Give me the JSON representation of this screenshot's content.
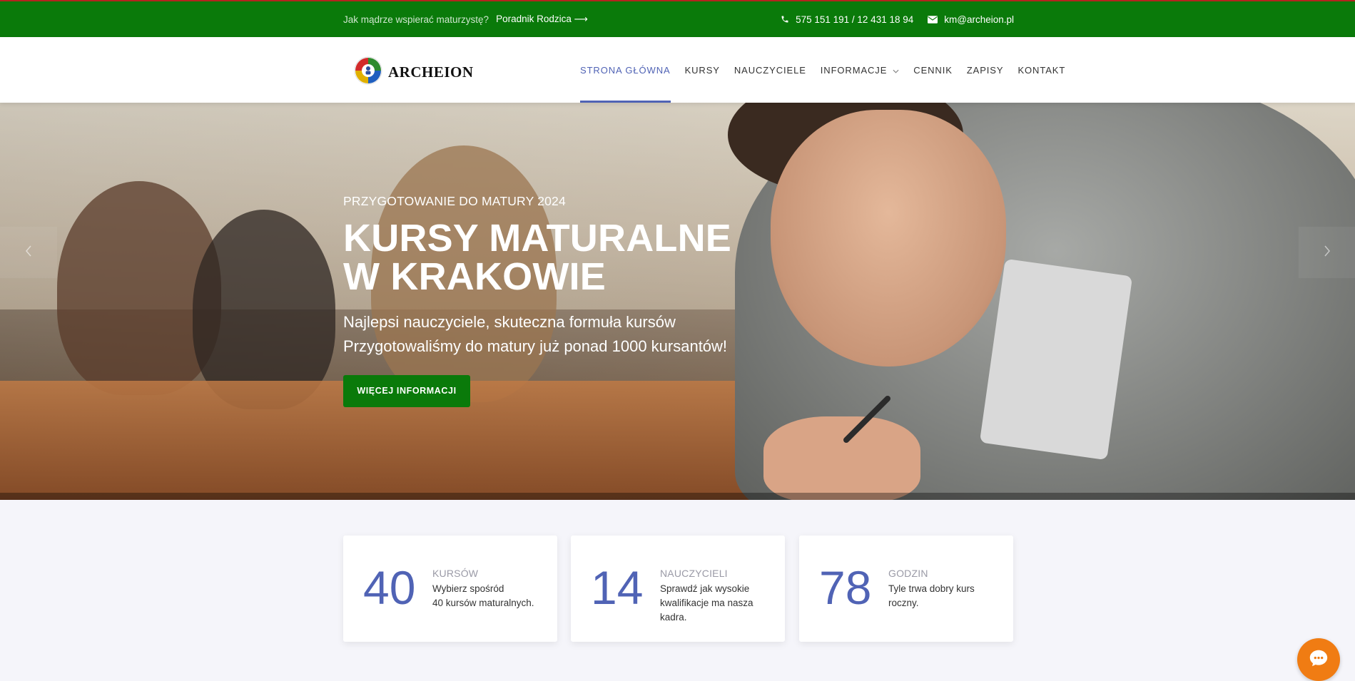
{
  "topbar": {
    "question": "Jak mądrze wspierać maturzystę?",
    "guide_link": "Poradnik Rodzica ⟶",
    "phone": "575 151 191 / 12 431 18 94",
    "email": "km@archeion.pl"
  },
  "header": {
    "logo_text": "ARCHEION",
    "nav": [
      {
        "label": "STRONA GŁÓWNA",
        "active": true
      },
      {
        "label": "KURSY"
      },
      {
        "label": "NAUCZYCIELE"
      },
      {
        "label": "INFORMACJE",
        "has_dropdown": true
      },
      {
        "label": "CENNIK"
      },
      {
        "label": "ZAPISY"
      },
      {
        "label": "KONTAKT"
      }
    ]
  },
  "hero": {
    "eyebrow": "PRZYGOTOWANIE DO MATURY 2024",
    "title_line1": "KURSY MATURALNE",
    "title_line2": "W KRAKOWIE",
    "subtitle_line1": "Najlepsi nauczyciele, skuteczna formuła kursów",
    "subtitle_line2": "Przygotowaliśmy do matury już ponad 1000 kursantów!",
    "button": "WIĘCEJ INFORMACJI"
  },
  "stats": [
    {
      "number": "40",
      "label": "KURSÓW",
      "desc_line1": "Wybierz spośród",
      "desc_line2": "40 kursów maturalnych."
    },
    {
      "number": "14",
      "label": "NAUCZYCIELI",
      "desc": "Sprawdź jak wysokie kwalifikacje ma nasza kadra."
    },
    {
      "number": "78",
      "label": "GODZIN",
      "desc": "Tyle trwa dobry kurs roczny."
    }
  ],
  "colors": {
    "brand_green": "#0a7a0a",
    "accent_blue": "#5063b5",
    "chat_orange": "#f07c13"
  },
  "icons": {
    "phone": "phone-icon",
    "email": "envelope-icon",
    "chat": "chat-bubble-icon",
    "prev": "chevron-left-icon",
    "next": "chevron-right-icon"
  }
}
